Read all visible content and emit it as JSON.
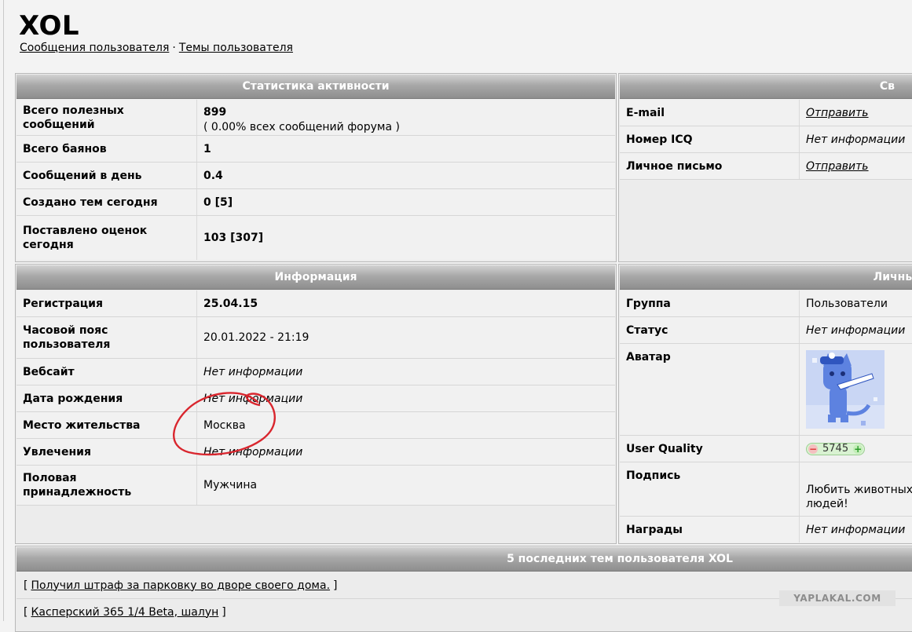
{
  "profile": {
    "username": "XOL",
    "links": {
      "posts": "Сообщения пользователя",
      "separator": "·",
      "topics": "Темы пользователя"
    }
  },
  "stats": {
    "title": "Статистика активности",
    "rows": [
      {
        "label": "Всего полезных сообщений",
        "value": "899",
        "value2": "( 0.00% всех сообщений форума )"
      },
      {
        "label": "Всего баянов",
        "value": "1"
      },
      {
        "label": "Сообщений в день",
        "value": "0.4"
      },
      {
        "label": "Создано тем сегодня",
        "value": "0 [5]"
      },
      {
        "label": "Поставлено оценок сегодня",
        "value": "103 [307]"
      }
    ]
  },
  "contacts": {
    "title": "Св",
    "rows": [
      {
        "label": "E-mail",
        "value": "Отправить"
      },
      {
        "label": "Номер ICQ",
        "value": "Нет информации"
      },
      {
        "label": "Личное письмо",
        "value": "Отправить"
      }
    ]
  },
  "info": {
    "title": "Информация",
    "rows": [
      {
        "label": "Регистрация",
        "value": "25.04.15"
      },
      {
        "label": "Часовой пояс пользователя",
        "value": "20.01.2022 - 21:19"
      },
      {
        "label": "Вебсайт",
        "value": "Нет информации"
      },
      {
        "label": "Дата рождения",
        "value": "Нет информации"
      },
      {
        "label": "Место жительства",
        "value": "Москва"
      },
      {
        "label": "Увлечения",
        "value": "Нет информации"
      },
      {
        "label": "Половая принадлежность",
        "value": "Мужчина"
      }
    ]
  },
  "personal": {
    "title": "Личны",
    "rows": [
      {
        "label": "Группа",
        "value": "Пользователи"
      },
      {
        "label": "Статус",
        "value": "Нет информации"
      },
      {
        "label": "Аватар"
      },
      {
        "label": "User Quality",
        "minus": "−",
        "value": "5745",
        "plus": "+"
      },
      {
        "label": "Подпись",
        "value": "Любить животных",
        "value2": "людей!"
      },
      {
        "label": "Награды",
        "value": "Нет информации"
      }
    ]
  },
  "topics": {
    "title": "5 последних тем пользователя XOL",
    "items": [
      {
        "open": "[",
        "title": "Получил штраф за парковку во дворе своего дома.",
        "close": "]"
      },
      {
        "open": "[",
        "title": "Касперский 365 1/4 Beta, шалун",
        "close": "]"
      }
    ]
  },
  "watermark": "YAPLAKAL.COM",
  "colors": {
    "header_gradient": "#9a9a9a",
    "panel_bg": "#ececec",
    "scribble": "#d9262e"
  }
}
